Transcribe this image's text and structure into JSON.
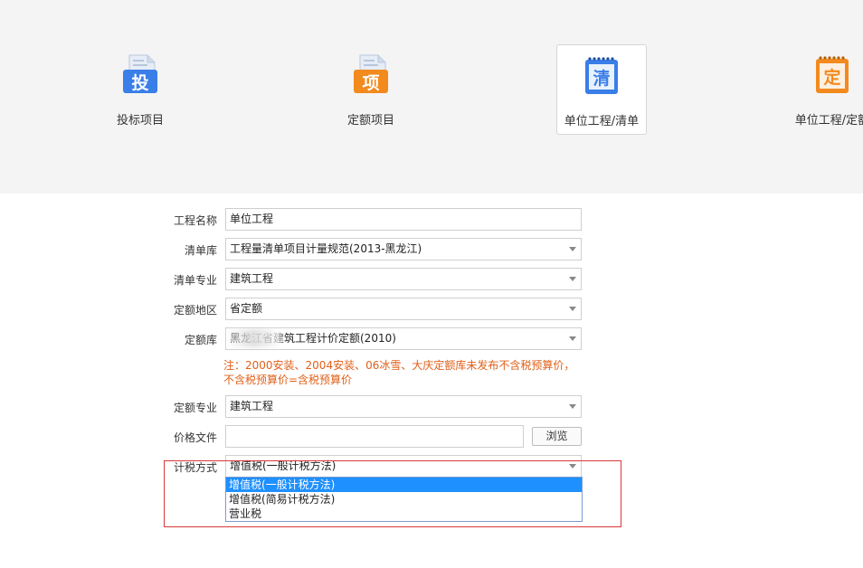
{
  "tiles": [
    {
      "label": "投标项目",
      "glyph": "投",
      "color": "#3a7ee8"
    },
    {
      "label": "定额项目",
      "glyph": "项",
      "color": "#f28a1e"
    },
    {
      "label": "单位工程/清单",
      "glyph": "清",
      "color": "#3a7ee8",
      "selected": true
    },
    {
      "label": "单位工程/定额",
      "glyph": "定",
      "color": "#f28a1e"
    }
  ],
  "form": {
    "project_name": {
      "label": "工程名称",
      "value": "单位工程"
    },
    "bill_lib": {
      "label": "清单库",
      "value": "工程量清单项目计量规范(2013-黑龙江)"
    },
    "bill_major": {
      "label": "清单专业",
      "value": "建筑工程"
    },
    "quota_region": {
      "label": "定额地区",
      "value": "省定额"
    },
    "quota_lib": {
      "label": "定额库",
      "value": "黑龙江省建筑工程计价定额(2010)"
    },
    "note_line1": "注：2000安装、2004安装、06冰雪、大庆定额库未发布不含税预算价，",
    "note_line2": "不含税预算价=含税预算价",
    "quota_major": {
      "label": "定额专业",
      "value": "建筑工程"
    },
    "price_file": {
      "label": "价格文件",
      "value": "",
      "browse_label": "浏览"
    },
    "tax_method": {
      "label": "计税方式",
      "value": "增值税(一般计税方法)",
      "options": [
        "增值税(一般计税方法)",
        "增值税(简易计税方法)",
        "营业税"
      ],
      "active_index": 0
    }
  }
}
